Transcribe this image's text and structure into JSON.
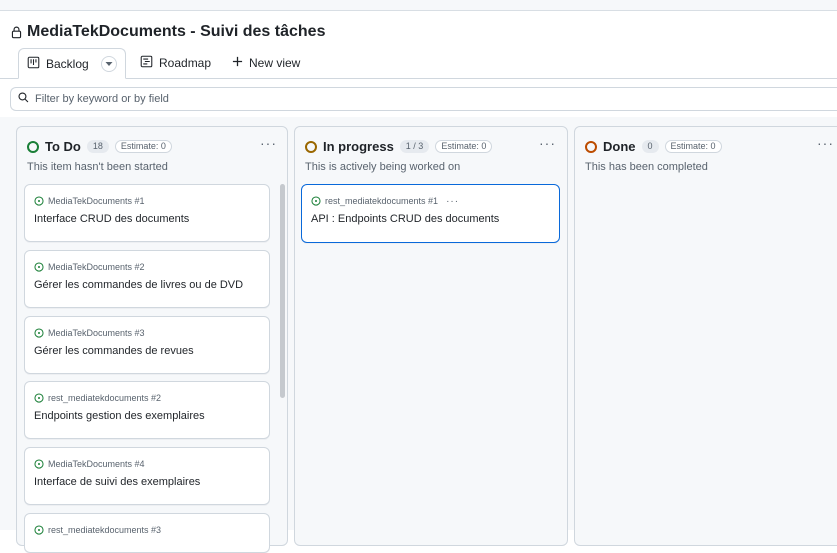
{
  "project": {
    "title": "MediaTekDocuments - Suivi des tâches",
    "icon": "lock-icon"
  },
  "views": {
    "tabs": [
      {
        "label": "Backlog",
        "icon": "board-icon",
        "active": true
      },
      {
        "label": "Roadmap",
        "icon": "roadmap-icon",
        "active": false
      },
      {
        "label": "New view",
        "icon": "plus-icon",
        "active": false
      }
    ]
  },
  "filter": {
    "placeholder": "Filter by keyword or by field",
    "icon": "search-icon"
  },
  "columns": [
    {
      "name": "To Do",
      "count": "18",
      "estimate": "Estimate: 0",
      "description": "This item hasn't been started",
      "status_color": "#1a7f37",
      "cards": [
        {
          "repo": "MediaTekDocuments #1",
          "title": "Interface CRUD des documents"
        },
        {
          "repo": "MediaTekDocuments #2",
          "title": "Gérer les commandes de livres ou de DVD"
        },
        {
          "repo": "MediaTekDocuments #3",
          "title": "Gérer les commandes de revues"
        },
        {
          "repo": "rest_mediatekdocuments #2",
          "title": "Endpoints gestion des exemplaires"
        },
        {
          "repo": "MediaTekDocuments #4",
          "title": "Interface de suivi des exemplaires"
        },
        {
          "repo": "rest_mediatekdocuments #3",
          "title": ""
        }
      ]
    },
    {
      "name": "In progress",
      "count": "1 / 3",
      "estimate": "Estimate: 0",
      "description": "This is actively being worked on",
      "status_color": "#9a6700",
      "cards": [
        {
          "repo": "rest_mediatekdocuments #1",
          "title": "API : Endpoints CRUD des documents",
          "menu": "···"
        }
      ]
    },
    {
      "name": "Done",
      "count": "0",
      "estimate": "Estimate: 0",
      "description": "This has been completed",
      "status_color": "#bc4c00",
      "cards": []
    }
  ],
  "colors": {
    "accent": "#0969da",
    "issue_open": "#1a7f37"
  }
}
